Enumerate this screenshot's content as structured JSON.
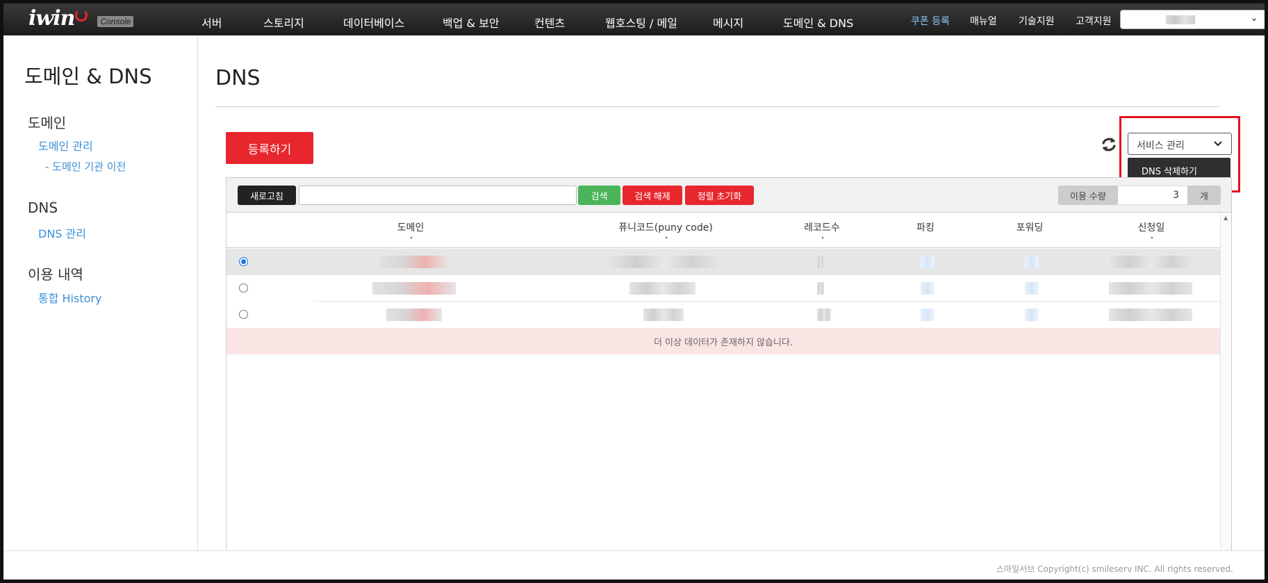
{
  "header": {
    "logo_text": "iwin",
    "console_badge": "Console",
    "nav": [
      "서버",
      "스토리지",
      "데이터베이스",
      "백업 & 보안",
      "컨텐츠",
      "웹호스팅 / 메일",
      "메시지",
      "도메인 & DNS"
    ],
    "right_links": {
      "coupon": "쿠폰 등록",
      "manual": "매뉴얼",
      "tech": "기술지원",
      "support": "고객지원"
    },
    "account_chevron": "⌄"
  },
  "sidebar": {
    "title": "도메인 & DNS",
    "sections": [
      {
        "heading": "도메인",
        "links": [
          "도메인 관리"
        ],
        "sub": [
          "- 도메인 기관 이전"
        ]
      },
      {
        "heading": "DNS",
        "links": [
          "DNS 관리"
        ]
      },
      {
        "heading": "이용 내역",
        "links": [
          "통합 History"
        ]
      }
    ]
  },
  "main": {
    "title": "DNS",
    "register_button": "등록하기",
    "service_select": {
      "selected": "서비스 관리",
      "menu_item": "DNS 삭제하기"
    },
    "toolbar": {
      "refresh": "새로고침",
      "search_value": "",
      "search": "검색",
      "clear_search": "검색 해제",
      "reset_sort": "정렬 초기화",
      "usage_label": "이용 수량",
      "usage_value": "3",
      "usage_unit": "개"
    },
    "table": {
      "columns": [
        "도메인",
        "퓨니코드(puny code)",
        "레코드수",
        "파킹",
        "포워딩",
        "신청일"
      ],
      "selected_row": 0,
      "no_more_data": "더 이상 데이터가 존재하지 않습니다."
    }
  },
  "footer": {
    "copyright": "스마일서브 Copyright(c) smileserv INC. All rights reserved."
  },
  "colors": {
    "accent_red": "#e8262d",
    "search_green": "#4bb35a",
    "link_blue": "#3b8fd6",
    "highlight": "#e3101c"
  }
}
